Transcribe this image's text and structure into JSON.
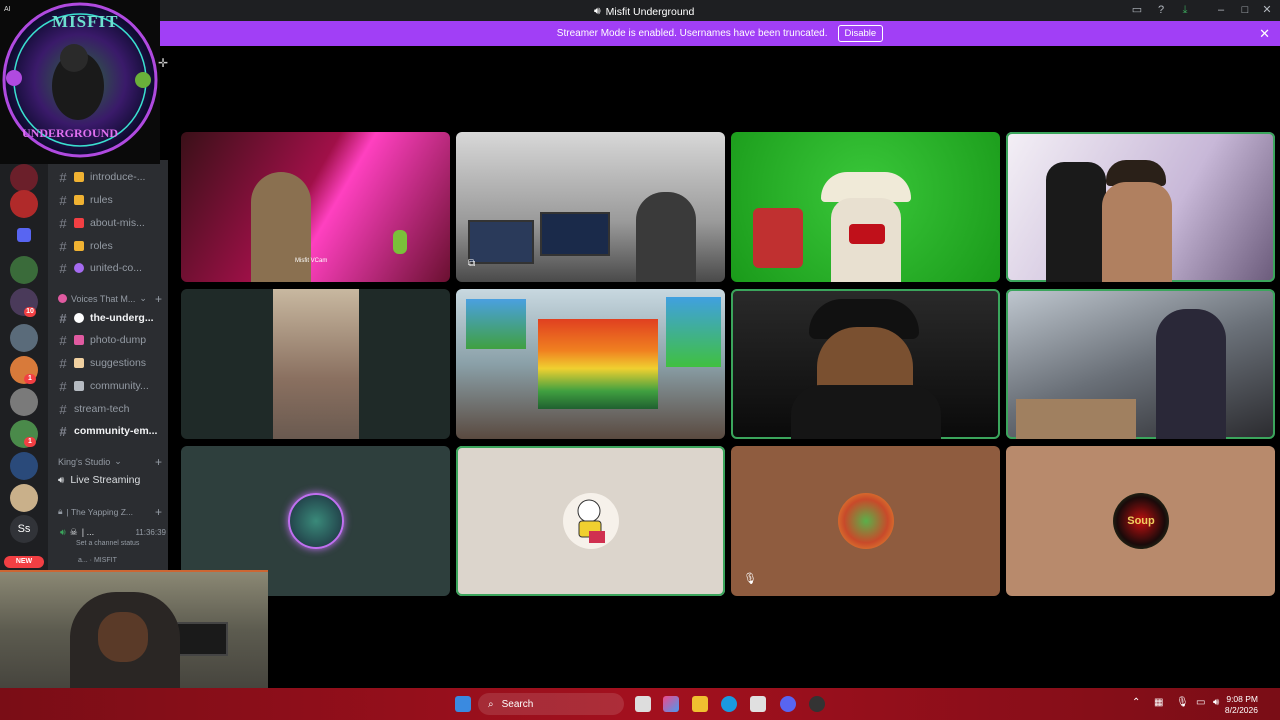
{
  "window": {
    "title": "Misfit Underground",
    "ai_label": "AI"
  },
  "banner": {
    "text": "Streamer Mode is enabled. Usernames have been truncated.",
    "button": "Disable"
  },
  "overlay": {
    "logo_top": "MISFIT",
    "logo_bottom": "UNDERGROUND"
  },
  "rail": {
    "badges": [
      "10",
      "1",
      "1"
    ],
    "new_label": "NEW",
    "dm_initials": "Ss"
  },
  "channels": [
    {
      "label": "introduce-...",
      "color": "#f0b232"
    },
    {
      "label": "rules",
      "color": "#f0b232"
    },
    {
      "label": "about-mis...",
      "color": "#f23f43"
    },
    {
      "label": "roles",
      "color": "#f0b232"
    },
    {
      "label": "united-co...",
      "color": "#a56bf0"
    }
  ],
  "voice_category": "Voices That M...",
  "channels2": [
    {
      "label": "the-underg...",
      "active": true,
      "color": "#ffffff"
    },
    {
      "label": "photo-dump",
      "color": "#e05aa0"
    },
    {
      "label": "suggestions",
      "color": "#f0d0a0"
    },
    {
      "label": "community...",
      "color": "#b5bac1"
    },
    {
      "label": "stream-tech",
      "color": ""
    },
    {
      "label": "community-em...",
      "active": true,
      "color": ""
    }
  ],
  "kings_category": "King's Studio",
  "live_streaming": "Live Streaming",
  "voice_status": {
    "channel": "| The Yapping Z...",
    "user": "| ...",
    "time": "11:36:39",
    "status_hint": "Set a channel status",
    "bottom": "a... · MISFIT"
  },
  "tiles": {
    "name_1": "Misfit VCam",
    "avatar_3": "Soup"
  },
  "taskbar": {
    "search": "Search",
    "time": "9:08 PM",
    "date": "8/2/2026"
  },
  "colors": {
    "accent": "#a13ff6",
    "speaking": "#3ba55c",
    "taskbar": "#a3101e"
  }
}
